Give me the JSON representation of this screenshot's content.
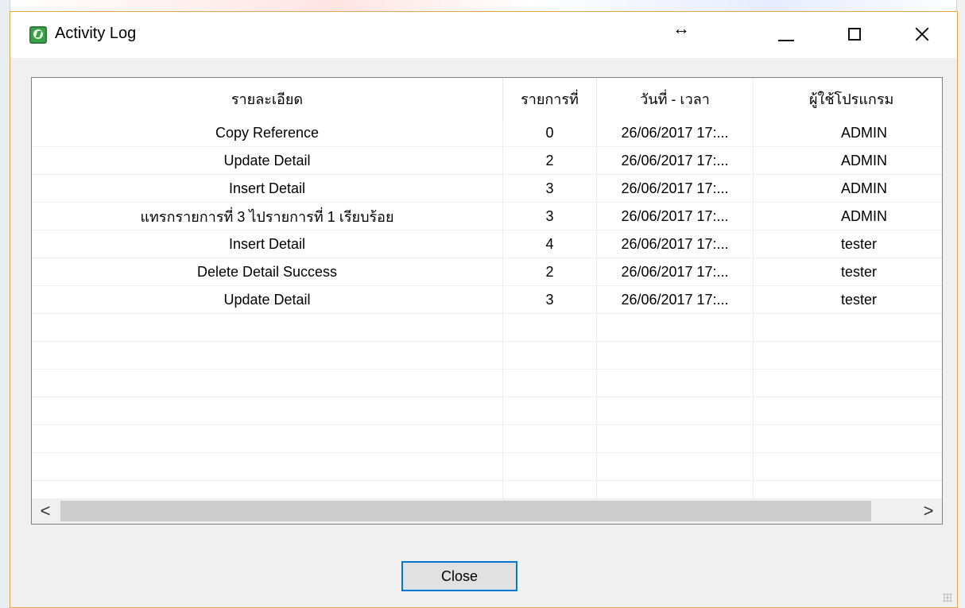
{
  "window": {
    "title": "Activity Log",
    "resize_cursor": "↔",
    "controls": [
      "minimize",
      "maximize",
      "close"
    ]
  },
  "table": {
    "columns": [
      "รายละเอียด",
      "รายการที่",
      "วันที่ - เวลา",
      "ผู้ใช้โปรแกรม"
    ],
    "rows": [
      [
        "Copy Reference",
        "0",
        "26/06/2017 17:...",
        "ADMIN"
      ],
      [
        "Update Detail",
        "2",
        "26/06/2017 17:...",
        "ADMIN"
      ],
      [
        "Insert Detail",
        "3",
        "26/06/2017 17:...",
        "ADMIN"
      ],
      [
        "แทรกรายการที่ 3 ไปรายการที่ 1 เรียบร้อย",
        "3",
        "26/06/2017 17:...",
        "ADMIN"
      ],
      [
        "Insert Detail",
        "4",
        "26/06/2017 17:...",
        "tester"
      ],
      [
        "Delete Detail Success",
        "2",
        "26/06/2017 17:...",
        "tester"
      ],
      [
        "Update Detail",
        "3",
        "26/06/2017 17:...",
        "tester"
      ]
    ],
    "empty_rows": 7
  },
  "scrollbar": {
    "left_arrow": "<",
    "right_arrow": ">"
  },
  "buttons": {
    "close_label": "Close"
  },
  "colors": {
    "accent": "#0078d7",
    "window_border": "#e8a54a",
    "dialog_bg": "#f0f0f0"
  },
  "icons": {
    "app": "app-icon",
    "minimize": "minimize-icon",
    "maximize": "maximize-icon",
    "close": "close-icon"
  }
}
